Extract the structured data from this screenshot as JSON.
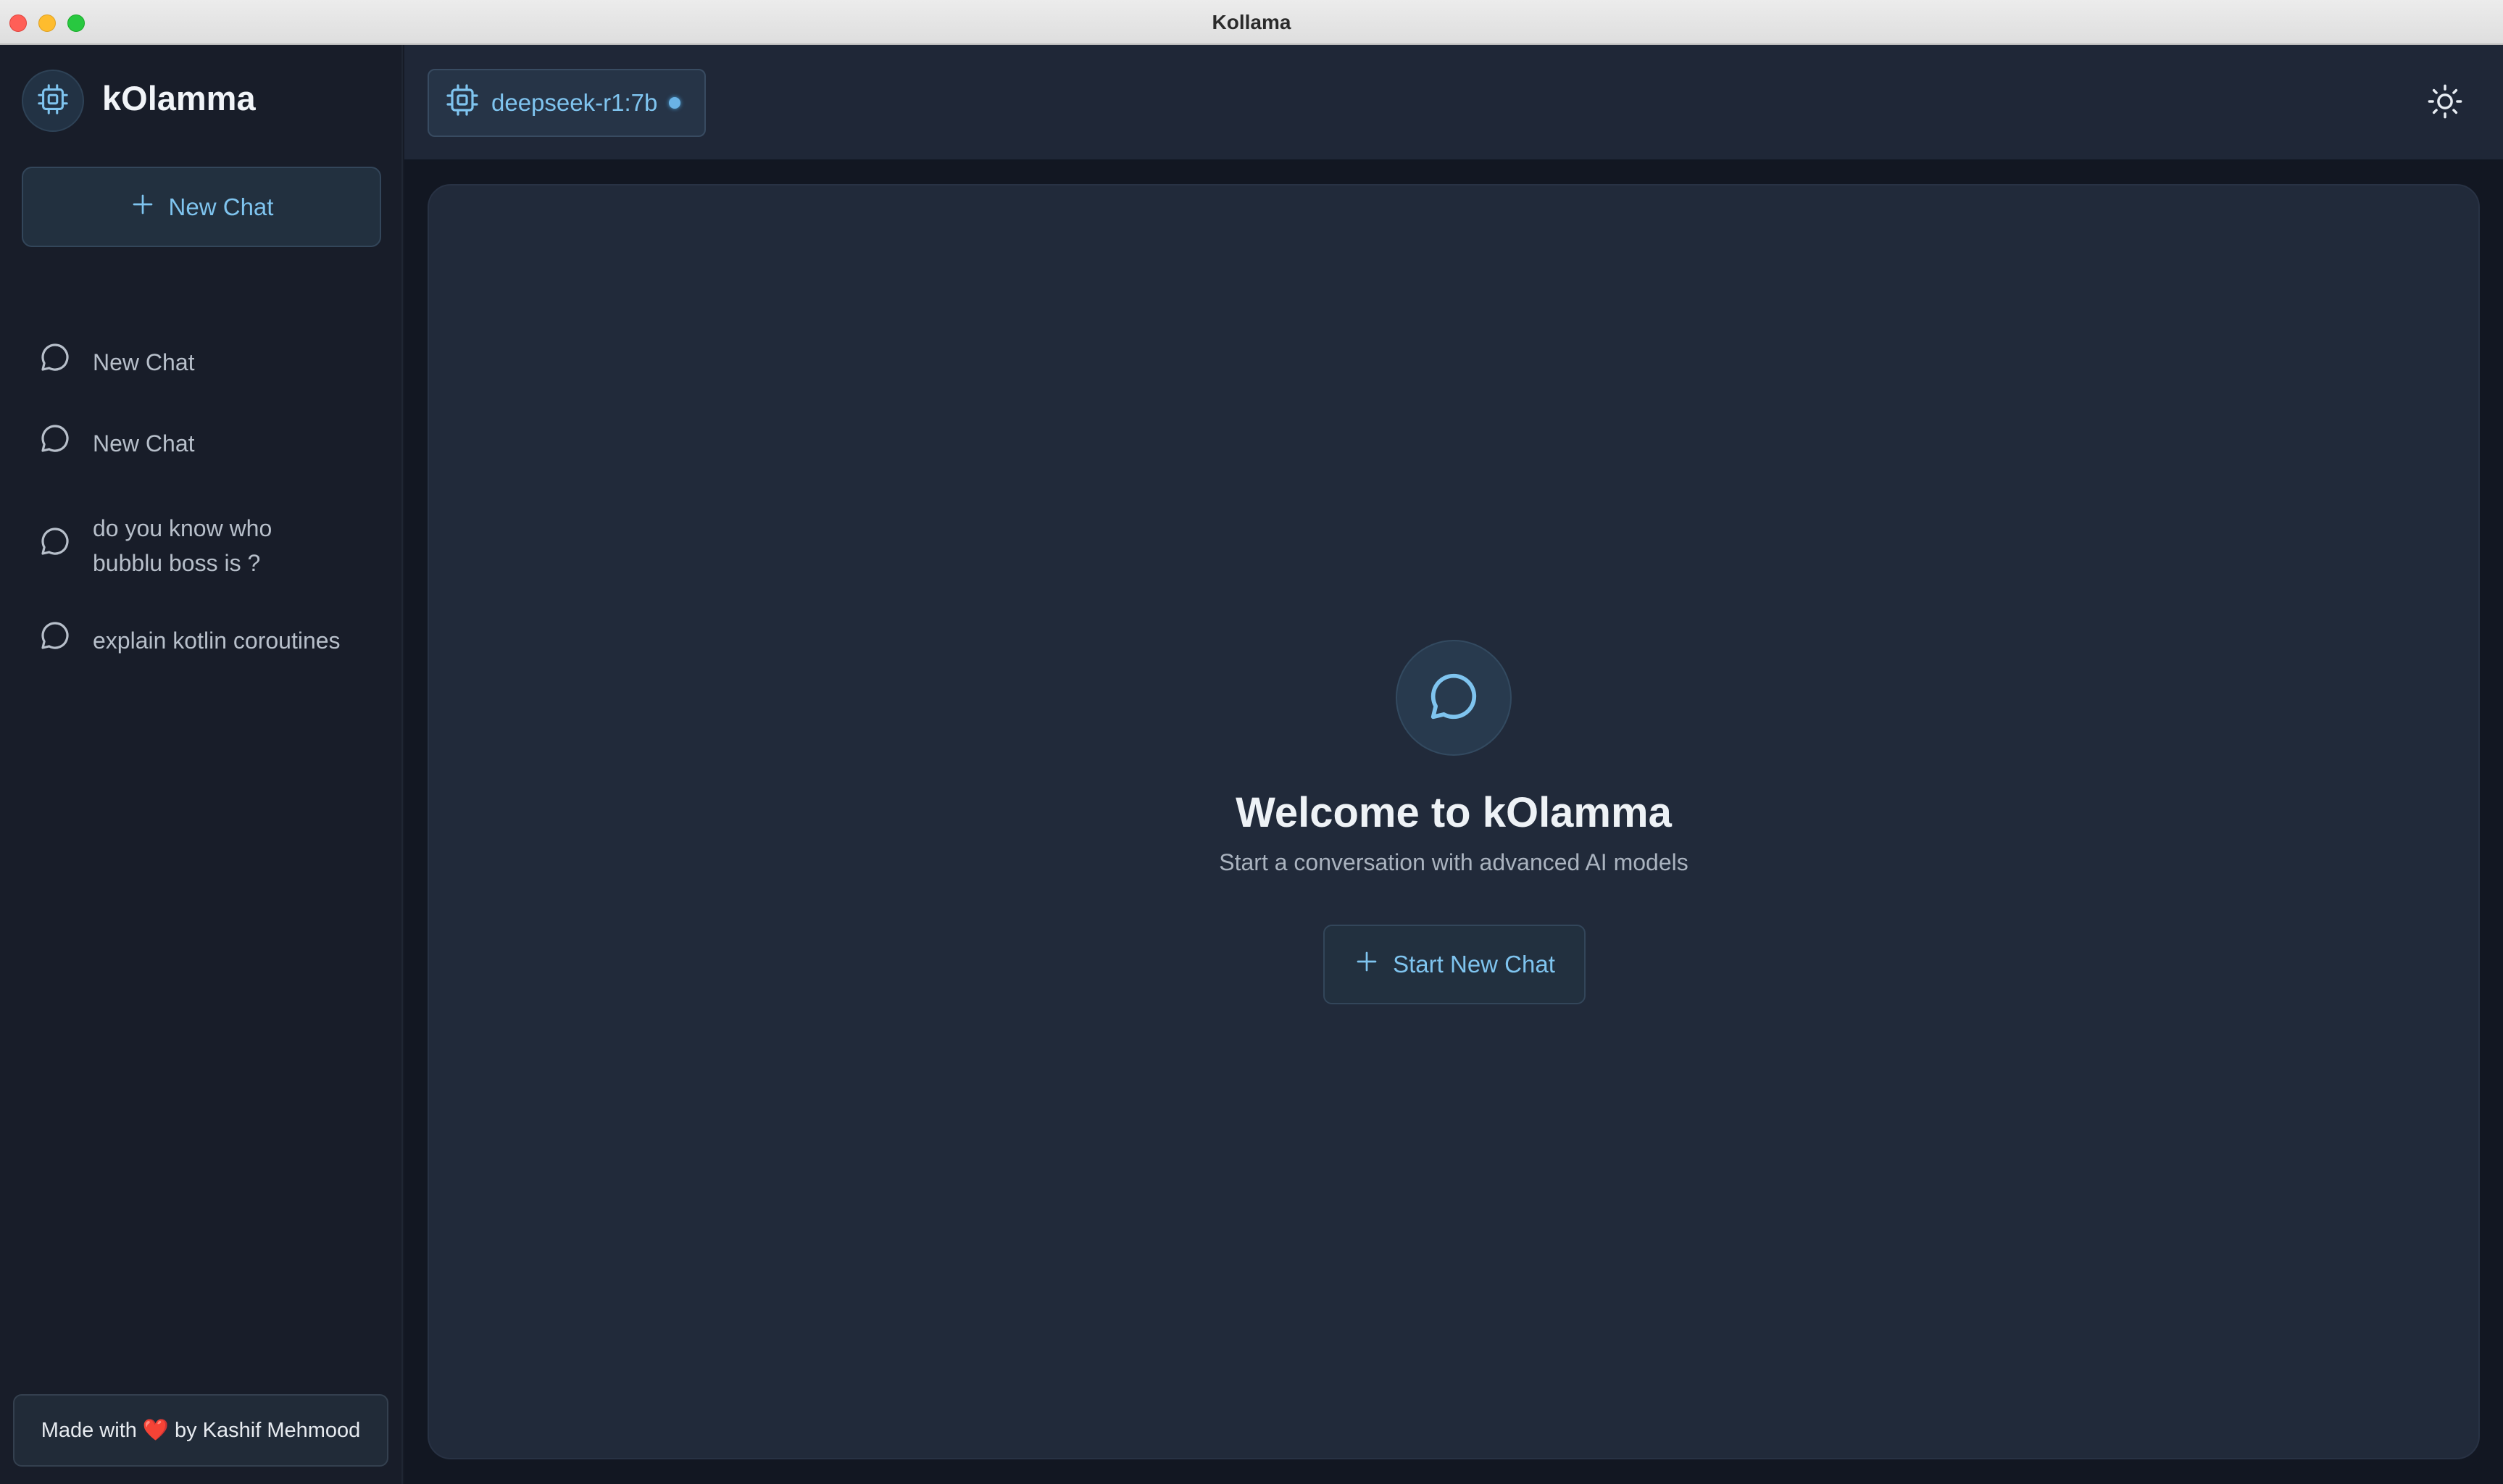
{
  "window": {
    "title": "Kollama"
  },
  "sidebar": {
    "app_name": "kOlamma",
    "new_chat_label": "New Chat",
    "chats": [
      {
        "label": "New Chat"
      },
      {
        "label": "New Chat"
      },
      {
        "label": "do you know who\nbubblu boss is ?"
      },
      {
        "label": "explain kotlin coroutines"
      }
    ],
    "footer": {
      "prefix": "Made with",
      "heart": "❤️",
      "suffix": "by Kashif Mehmood"
    }
  },
  "topbar": {
    "model_name": "deepseek-r1:7b",
    "model_status": "online"
  },
  "main": {
    "welcome_title": "Welcome to kOlamma",
    "welcome_subtitle": "Start a conversation with advanced AI models",
    "start_button_label": "Start New Chat"
  },
  "colors": {
    "accent": "#7fc4ef",
    "sidebar_bg": "#181d29",
    "panel_bg": "#212a3a",
    "status_dot": "#6ab3e6"
  },
  "icons": {
    "logo": "cpu-chip-icon",
    "new_chat": "plus-icon",
    "chat": "chat-bubble-icon",
    "theme": "sun-icon"
  }
}
